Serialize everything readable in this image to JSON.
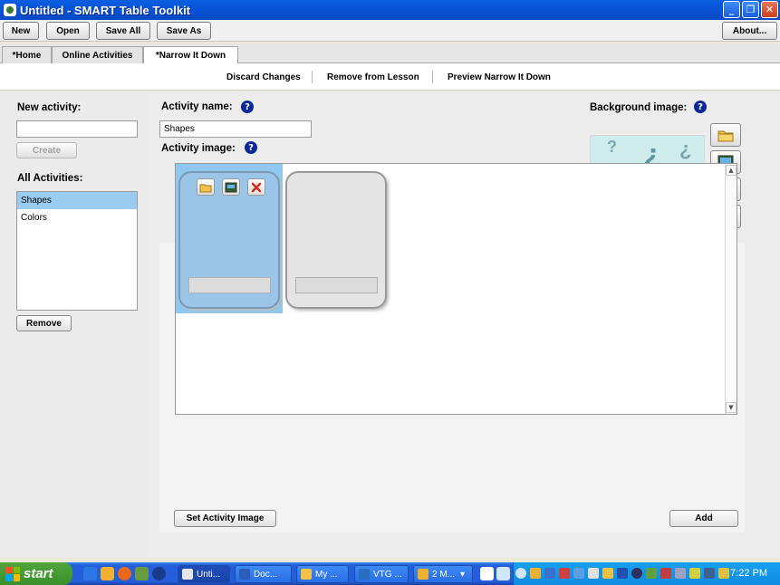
{
  "window": {
    "title": "Untitled - SMART Table Toolkit",
    "controls": {
      "minimize": "_",
      "restore": "❐",
      "close": "✕"
    }
  },
  "toolbar": {
    "new": "New",
    "open": "Open",
    "save_all": "Save All",
    "save_as": "Save As",
    "about": "About..."
  },
  "tabs": [
    {
      "label": "*Home"
    },
    {
      "label": "Online Activities"
    },
    {
      "label": "*Narrow It Down",
      "active": true
    }
  ],
  "actions": {
    "discard": "Discard Changes",
    "remove": "Remove from Lesson",
    "preview": "Preview Narrow It Down"
  },
  "left": {
    "new_activity_label": "New activity:",
    "new_activity_value": "",
    "create_button": "Create",
    "all_activities_label": "All Activities:",
    "activities": [
      "Shapes",
      "Colors"
    ],
    "selected_activity": "Shapes",
    "remove_button": "Remove"
  },
  "form": {
    "activity_name_label": "Activity name:",
    "activity_name_value": "Shapes",
    "activity_image_label": "Activity image:",
    "help_glyph": "?"
  },
  "background": {
    "label": "Background image:",
    "thumb_glyphs": [
      "?",
      "¿",
      "?",
      "?",
      "?",
      "¿"
    ]
  },
  "canvas": {
    "set_image_button": "Set Activity Image",
    "add_button": "Add",
    "scroll_up": "▲",
    "scroll_down": "▼"
  },
  "taskbar": {
    "start_label": "start",
    "tasks": [
      {
        "label": "Unti..."
      },
      {
        "label": "Doc..."
      },
      {
        "label": "My ..."
      },
      {
        "label": "VTG ..."
      },
      {
        "label": "2 M..."
      }
    ],
    "clock": "7:22 PM"
  },
  "colors": {
    "titlebar": "#0a5fe0",
    "selection": "#99ccf0",
    "help_icon": "#0a2898",
    "taskbar": "#245edb",
    "start": "#3c8f2a",
    "delete_red": "#d42a1a"
  }
}
